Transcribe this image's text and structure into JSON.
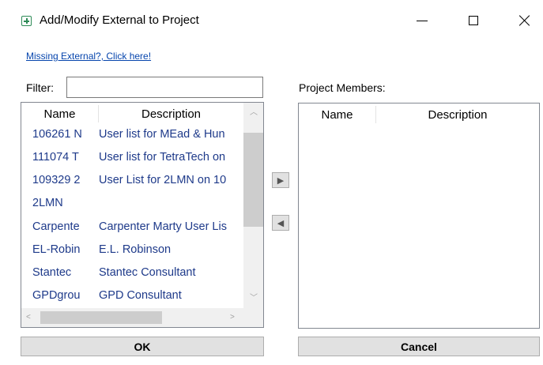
{
  "window": {
    "title": "Add/Modify External to Project",
    "app_icon": "plus-square-icon",
    "controls": [
      "minimize-icon",
      "maximize-icon",
      "close-icon"
    ]
  },
  "missing_link": "Missing External?, Click here!",
  "filter": {
    "label": "Filter:",
    "value": "",
    "placeholder": ""
  },
  "available_list": {
    "columns": [
      "Name",
      "Description"
    ],
    "rows": [
      {
        "name": "106261 N",
        "description": "User list for MEad & Hun"
      },
      {
        "name": "111074 T",
        "description": "User list for TetraTech on"
      },
      {
        "name": "109329 2",
        "description": "User List for 2LMN on 10"
      },
      {
        "name": "2LMN",
        "description": ""
      },
      {
        "name": "Carpente",
        "description": "Carpenter Marty User Lis"
      },
      {
        "name": "EL-Robin",
        "description": "E.L. Robinson"
      },
      {
        "name": "Stantec",
        "description": "Stantec Consultant"
      },
      {
        "name": "GPDgrou",
        "description": "GPD Consultant"
      }
    ]
  },
  "members": {
    "label": "Project Members:",
    "columns": [
      "Name",
      "Description"
    ],
    "rows": []
  },
  "move_buttons": {
    "add": "▶",
    "remove": "◀"
  },
  "buttons": {
    "ok": "OK",
    "cancel": "Cancel"
  }
}
